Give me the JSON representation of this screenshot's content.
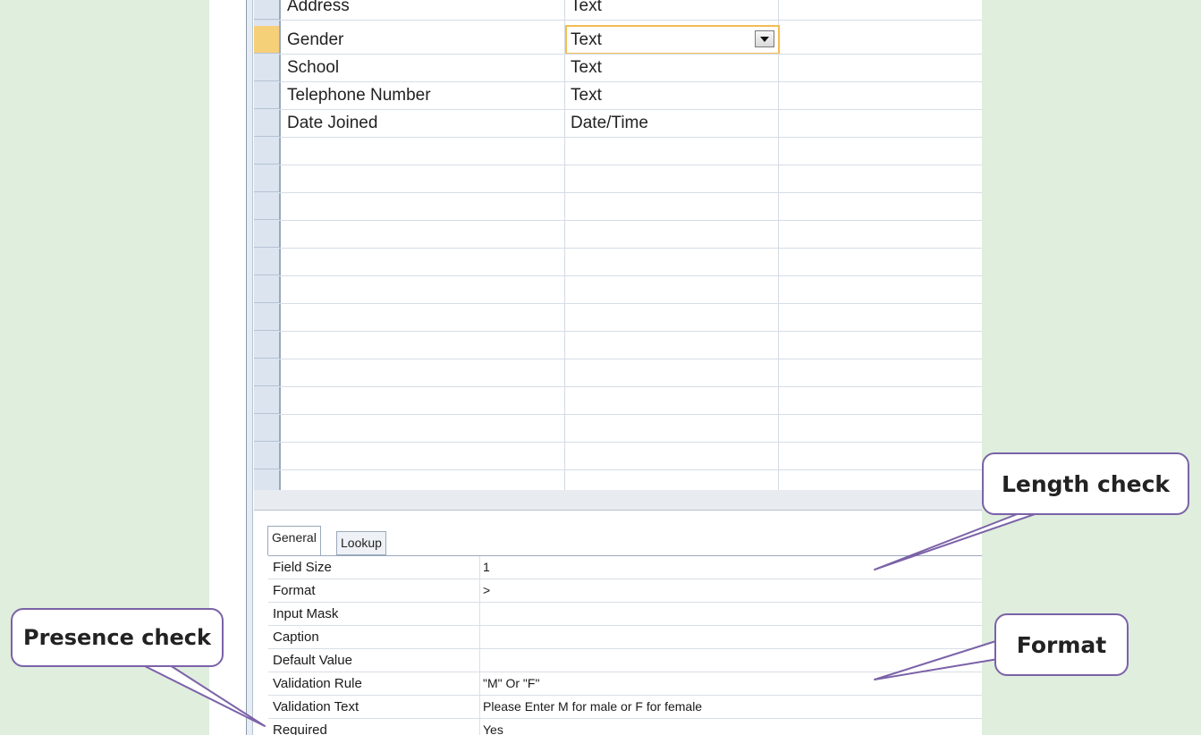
{
  "design_grid": {
    "rows": [
      {
        "field": "Address",
        "type": "Text"
      },
      {
        "field": "Gender",
        "type": "Text"
      },
      {
        "field": "School",
        "type": "Text"
      },
      {
        "field": "Telephone Number",
        "type": "Text"
      },
      {
        "field": "Date Joined",
        "type": "Date/Time"
      }
    ],
    "selected_row": "Gender"
  },
  "field_properties": {
    "tabs": [
      "General",
      "Lookup"
    ],
    "rows": [
      {
        "label": "Field Size",
        "value": "1"
      },
      {
        "label": "Format",
        "value": ">"
      },
      {
        "label": "Input Mask",
        "value": ""
      },
      {
        "label": "Caption",
        "value": ""
      },
      {
        "label": "Default Value",
        "value": ""
      },
      {
        "label": "Validation Rule",
        "value": "\"M\" Or \"F\""
      },
      {
        "label": "Validation Text",
        "value": "Please Enter M for male or F for female"
      },
      {
        "label": "Required",
        "value": "Yes"
      }
    ]
  },
  "callouts": {
    "length_check": "Length check",
    "format": "Format",
    "presence_check": "Presence check"
  },
  "colors": {
    "background": "#dfeedd",
    "callout_border": "#7b62a8",
    "active_row_selector": "#f6cf79",
    "active_cell_border": "#f2be52"
  },
  "icons": {
    "dropdown": "chevron-down-icon"
  }
}
